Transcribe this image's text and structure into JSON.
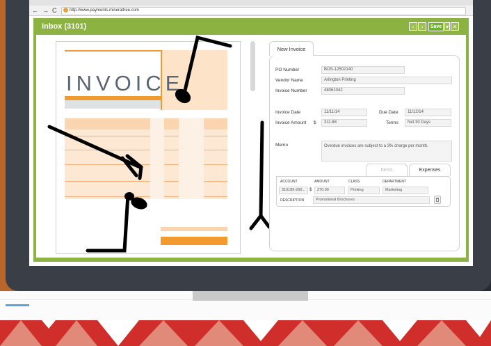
{
  "browser": {
    "url": "http://www.payments.mineraltree.com",
    "nav_back": "←",
    "nav_forward": "→",
    "nav_reload": "C"
  },
  "app": {
    "title": "Inbox (3101)",
    "save_label": "Save",
    "accent_color": "#8cb241"
  },
  "invoice_image": {
    "heading": "INVOICE"
  },
  "form": {
    "tab_label": "New Invoice",
    "po_number_label": "PO Number",
    "po_number_value": "BOS-12502140",
    "vendor_name_label": "Vendor Name",
    "vendor_name_value": "Arlington Printing",
    "invoice_number_label": "Invoice Number",
    "invoice_number_value": "48061042",
    "invoice_date_label": "Invoice Date",
    "invoice_date_value": "11/11/14",
    "due_date_label": "Due Date",
    "due_date_value": "11/12/14",
    "invoice_amount_label": "Invoice Amount",
    "currency_symbol": "$",
    "invoice_amount_value": "311.88",
    "terms_label": "Terms",
    "terms_value": "Net 30 Days",
    "memo_label": "Memo",
    "memo_value": "Overdue invoices are subject to a 3% charge per month."
  },
  "lines": {
    "tabs": [
      "Items",
      "Expenses"
    ],
    "active_tab": "Expenses",
    "headers": [
      "ACCOUNT",
      "AMOUNT",
      "CLASS",
      "DEPARTMENT"
    ],
    "row": {
      "account": "310189-260...",
      "currency_symbol": "$",
      "amount": "270.00",
      "class": "Printing",
      "department": "Marketing"
    },
    "description_label": "DESCRIPTION",
    "description_value": "Promotional Brochures"
  }
}
